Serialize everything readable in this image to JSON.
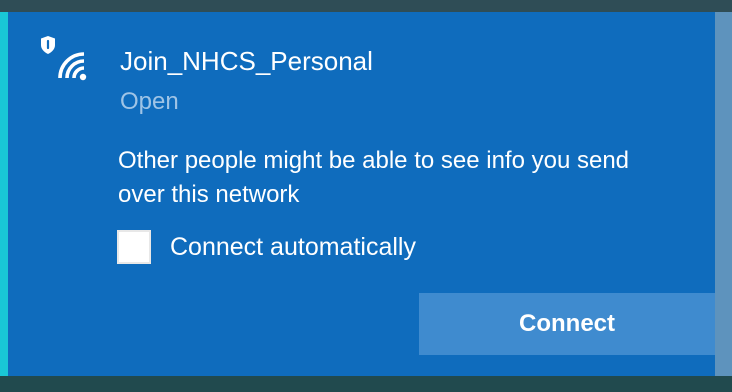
{
  "network": {
    "name": "Join_NHCS_Personal",
    "status": "Open",
    "icon": "wifi-shield-icon"
  },
  "warning": {
    "message": "Other people might be able to see info you send over this network"
  },
  "auto_connect": {
    "label": "Connect automatically",
    "checked": false
  },
  "actions": {
    "connect_label": "Connect"
  },
  "colors": {
    "panel": "#0f6cbd",
    "accent": "#19c7d6",
    "button": "#3f8bcf",
    "status_text": "#9fc4e6"
  }
}
